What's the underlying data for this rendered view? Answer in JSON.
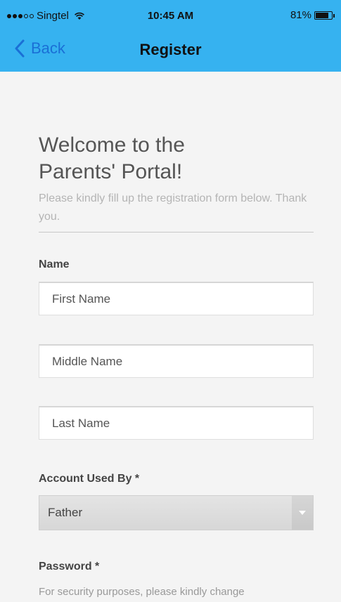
{
  "status_bar": {
    "carrier": "Singtel",
    "time": "10:45 AM",
    "battery": "81%",
    "battery_level": 0.81
  },
  "nav": {
    "back_label": "Back",
    "title": "Register"
  },
  "welcome": {
    "heading_line1": "Welcome to the",
    "heading_line2": "Parents' Portal!",
    "subtitle": "Please kindly fill up the registration form below. Thank you."
  },
  "form": {
    "name_label": "Name",
    "first_name_placeholder": "First Name",
    "middle_name_placeholder": "Middle Name",
    "last_name_placeholder": "Last Name",
    "account_label": "Account Used By *",
    "account_value": "Father",
    "password_label": "Password *",
    "password_hint": "For security purposes, please kindly change"
  },
  "colors": {
    "header": "#36b2f0",
    "back_link": "#1a6fd6",
    "background": "#f4f4f4"
  }
}
